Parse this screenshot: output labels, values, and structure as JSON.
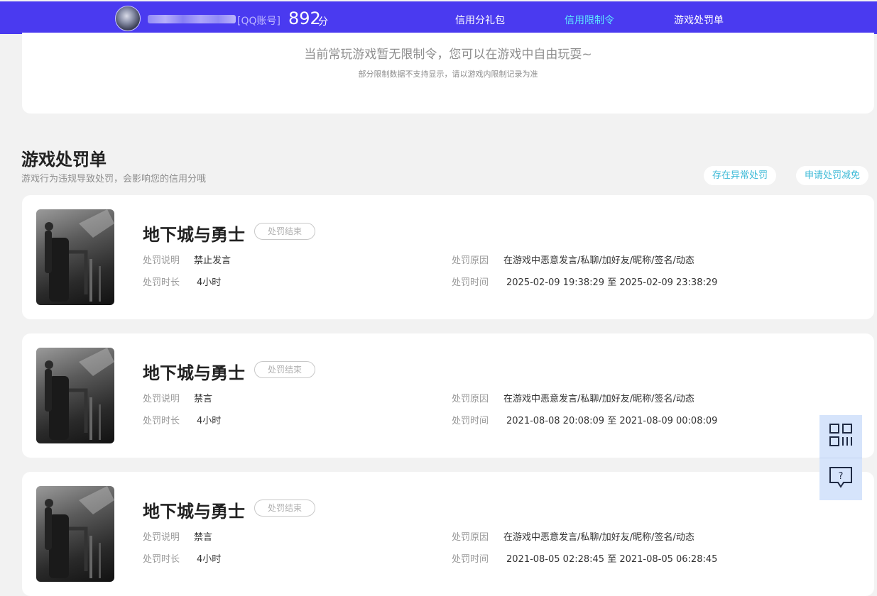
{
  "header": {
    "account_type": "[QQ账号]",
    "score": "892",
    "score_unit": "分",
    "nav": [
      {
        "label": "信用分礼包",
        "active": false
      },
      {
        "label": "信用限制令",
        "active": true
      },
      {
        "label": "游戏处罚单",
        "active": false
      }
    ]
  },
  "restriction": {
    "message": "当前常玩游戏暂无限制令，您可以在游戏中自由玩耍~",
    "note": "部分限制数据不支持显示，请以游戏内限制记录为准"
  },
  "penalty_section": {
    "title": "游戏处罚单",
    "subtitle": "游戏行为违规导致处罚，会影响您的信用分哦",
    "buttons": {
      "report_abnormal": "存在异常处罚",
      "apply_reduction": "申请处罚减免"
    },
    "labels": {
      "description": "处罚说明",
      "duration": "处罚时长",
      "reason": "处罚原因",
      "time": "处罚时间"
    },
    "items": [
      {
        "game": "地下城与勇士",
        "status": "处罚结束",
        "description": "禁止发言",
        "duration": "4小时",
        "reason": "在游戏中恶意发言/私聊/加好友/昵称/签名/动态",
        "time": "2025-02-09 19:38:29 至 2025-02-09 23:38:29"
      },
      {
        "game": "地下城与勇士",
        "status": "处罚结束",
        "description": "禁言",
        "duration": "4小时",
        "reason": "在游戏中恶意发言/私聊/加好友/昵称/签名/动态",
        "time": "2021-08-08 20:08:09 至 2021-08-09 00:08:09"
      },
      {
        "game": "地下城与勇士",
        "status": "处罚结束",
        "description": "禁言",
        "duration": "4小时",
        "reason": "在游戏中恶意发言/私聊/加好友/昵称/签名/动态",
        "time": "2021-08-05 02:28:45 至 2021-08-05 06:28:45"
      }
    ]
  },
  "float_tools": {
    "icons": [
      "qr-code-icon",
      "help-chat-icon"
    ]
  },
  "colors": {
    "header_bg": "#4a3af0",
    "nav_active": "#5ee9ff",
    "link_teal": "#3dbad7",
    "page_bg": "#f2f2f2"
  }
}
